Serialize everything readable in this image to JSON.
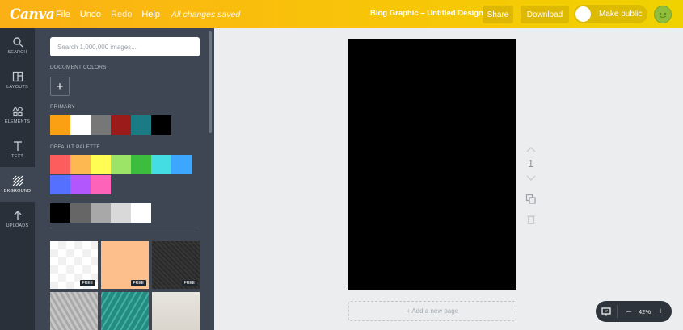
{
  "topbar": {
    "logo": "Canva",
    "menu": [
      "File",
      "Undo",
      "Redo",
      "Help"
    ],
    "status": "All changes saved",
    "doc_title": "Blog Graphic – Untitled Design",
    "share_label": "Share",
    "download_label": "Download",
    "make_public_label": "Make public"
  },
  "rail": [
    {
      "label": "SEARCH",
      "icon": "search-icon"
    },
    {
      "label": "LAYOUTS",
      "icon": "layouts-icon"
    },
    {
      "label": "ELEMENTS",
      "icon": "elements-icon"
    },
    {
      "label": "TEXT",
      "icon": "text-icon"
    },
    {
      "label": "BKGROUND",
      "icon": "background-icon",
      "active": true
    },
    {
      "label": "UPLOADS",
      "icon": "uploads-icon"
    }
  ],
  "panel": {
    "search_placeholder": "Search 1,000,000 images...",
    "document_colors_title": "DOCUMENT COLORS",
    "primary_title": "PRIMARY",
    "primary_colors": [
      "#fb9f13",
      "#ffffff",
      "#777777",
      "#9b1b1b",
      "#1a7b85",
      "#000000"
    ],
    "default_palette_title": "DEFAULT PALETTE",
    "palette_row1": [
      "#fe5d5d",
      "#feb851",
      "#fffc54",
      "#9be468",
      "#3dbd3d",
      "#43dde3",
      "#3da6fe"
    ],
    "palette_row2": [
      "#556ffe",
      "#b256fe",
      "#fe63ba"
    ],
    "gray_row": [
      "#000000",
      "#666666",
      "#a8a8a8",
      "#d9d9d9",
      "#ffffff"
    ],
    "free_label": "FREE"
  },
  "canvas": {
    "page_number": "1",
    "add_page_label": "+ Add a new page",
    "page_color": "#000000"
  },
  "zoom": {
    "value": "42%",
    "minus": "–",
    "plus": "+"
  }
}
